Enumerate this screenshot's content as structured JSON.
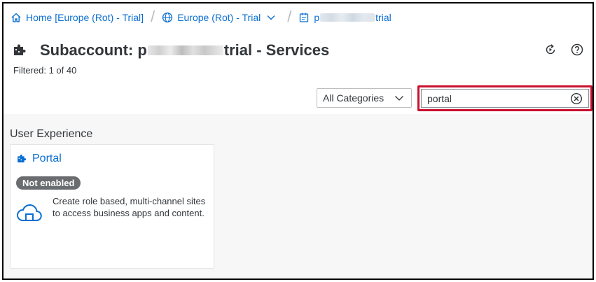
{
  "breadcrumb": {
    "items": [
      {
        "icon": "home-icon",
        "label": "Home [Europe (Rot) - Trial]"
      },
      {
        "icon": "globe-icon",
        "label": "Europe (Rot) - Trial"
      },
      {
        "icon": "subaccount-icon",
        "label_prefix": "p",
        "label_suffix": "trial"
      }
    ]
  },
  "header": {
    "title_prefix": "Subaccount: p",
    "title_suffix": "trial - Services",
    "filtered_text": "Filtered: 1 of 40"
  },
  "toolbar": {
    "category_value": "All Categories",
    "search_value": "portal"
  },
  "content": {
    "group_title": "User Experience",
    "tiles": [
      {
        "title": "Portal",
        "status": "Not enabled",
        "description": "Create role based, multi-channel sites to access business apps and content."
      }
    ]
  },
  "colors": {
    "link_blue": "#0a6ed1",
    "highlight_red": "#c8102e",
    "badge_gray": "#6a6d70",
    "content_bg": "#f7f7f7"
  }
}
